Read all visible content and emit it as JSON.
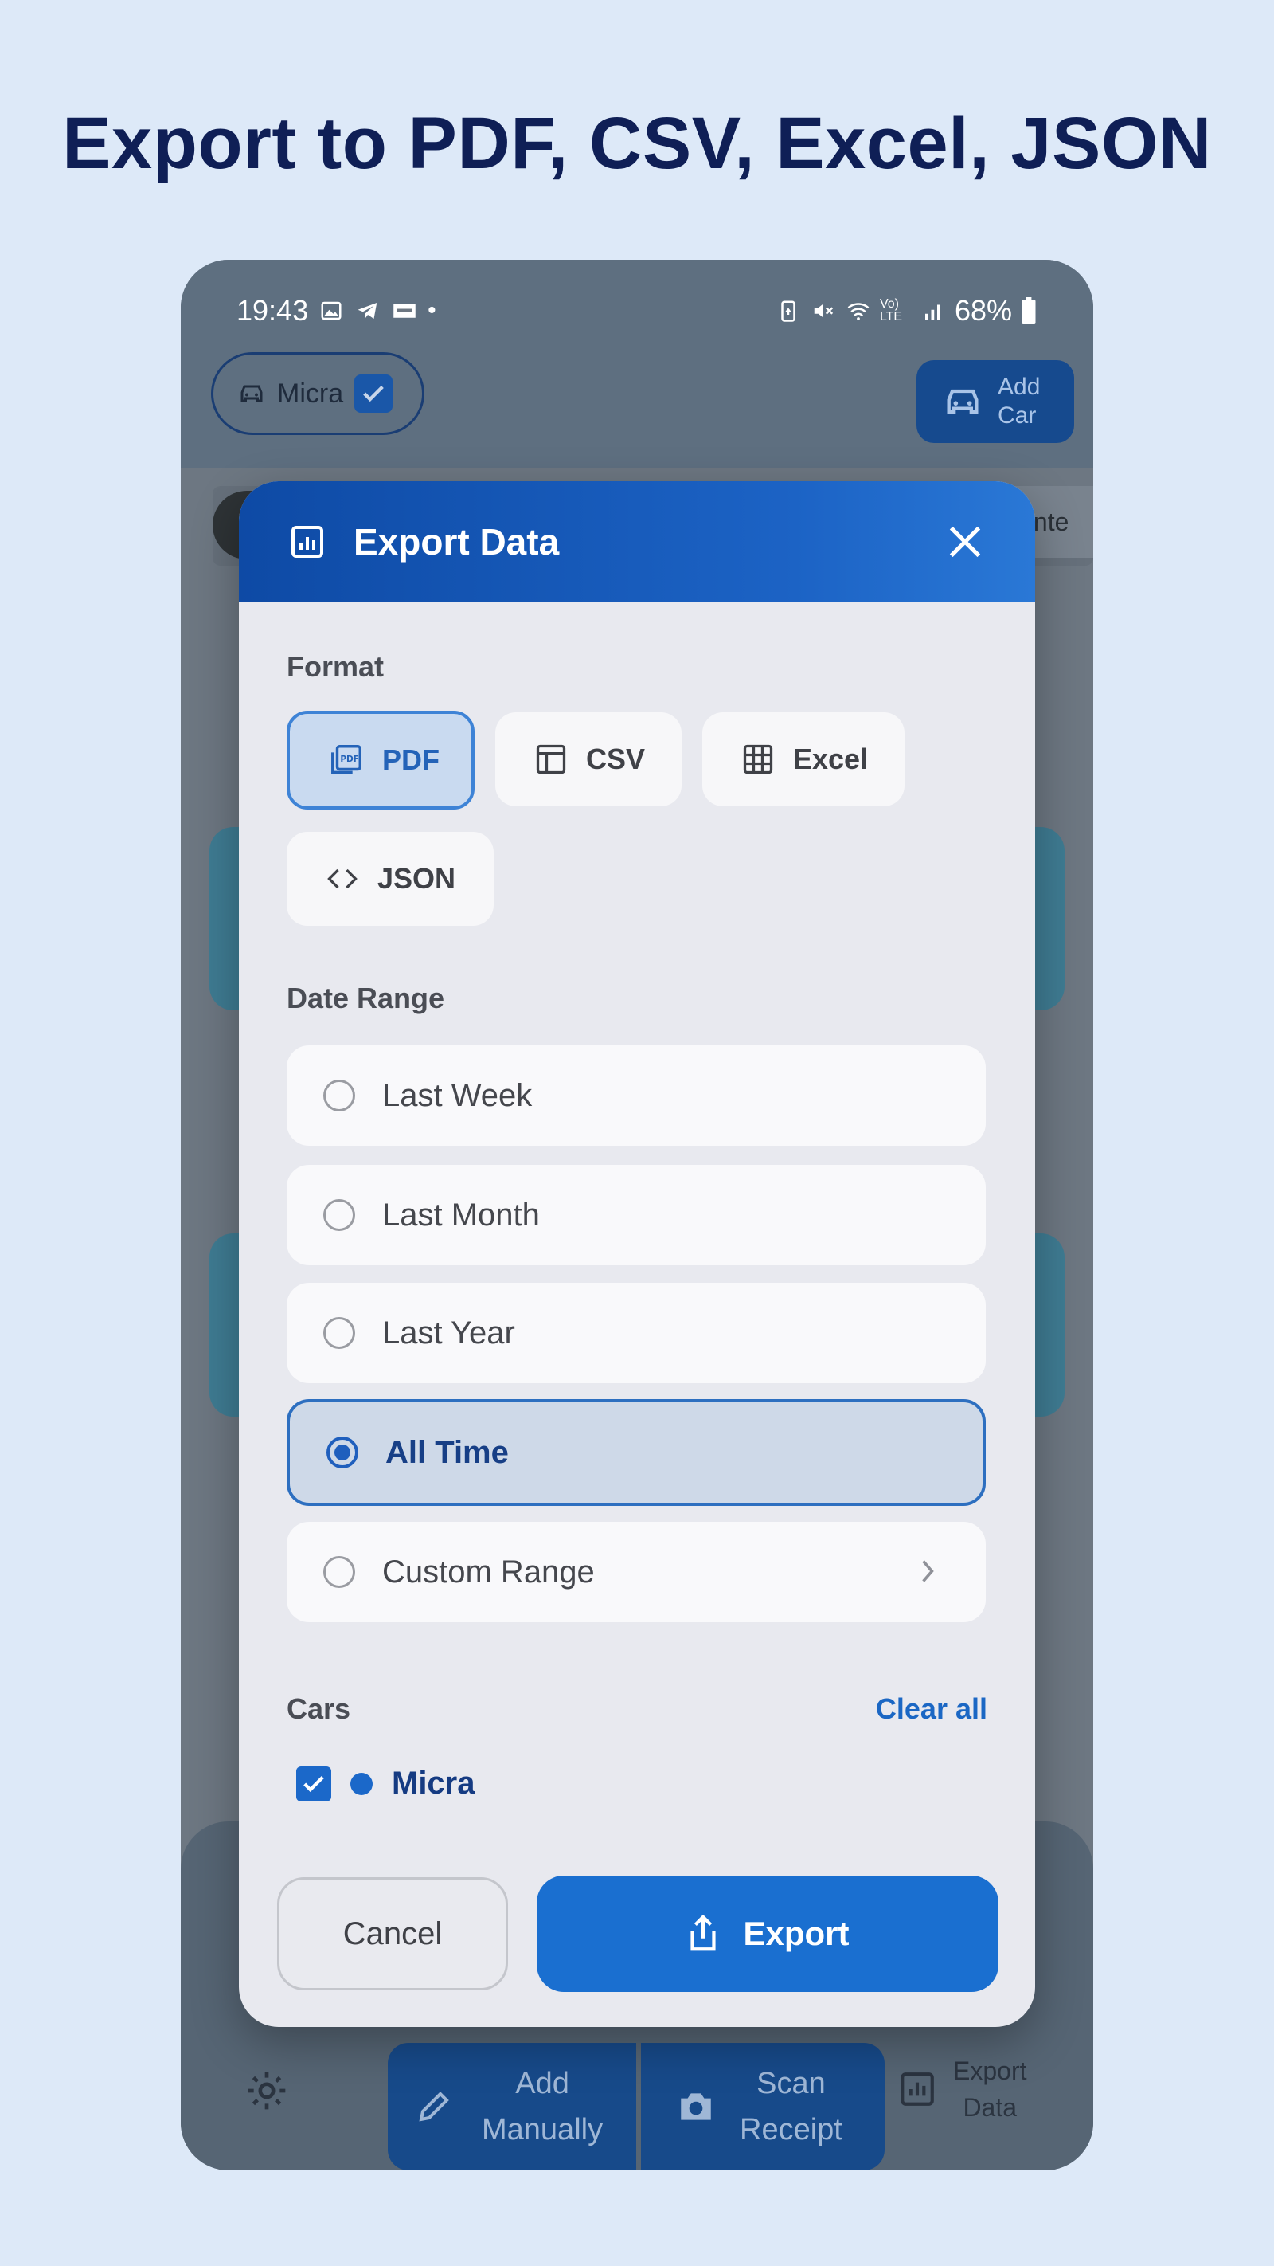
{
  "headline": "Export to PDF, CSV, Excel, JSON",
  "status_bar": {
    "time": "19:43",
    "battery": "68%",
    "network": "Vo) LTE"
  },
  "app": {
    "car_chip_label": "Micra",
    "add_car_line1": "Add",
    "add_car_line2": "Car",
    "bg_tab_text": "ainte"
  },
  "bottom_nav": {
    "add_manually_line1": "Add",
    "add_manually_line2": "Manually",
    "scan_receipt_line1": "Scan",
    "scan_receipt_line2": "Receipt",
    "export_data_line1": "Export",
    "export_data_line2": "Data"
  },
  "modal": {
    "title": "Export Data",
    "format_label": "Format",
    "formats": [
      {
        "label": "PDF",
        "selected": true
      },
      {
        "label": "CSV",
        "selected": false
      },
      {
        "label": "Excel",
        "selected": false
      },
      {
        "label": "JSON",
        "selected": false
      }
    ],
    "date_range_label": "Date Range",
    "date_ranges": [
      {
        "label": "Last Week",
        "selected": false
      },
      {
        "label": "Last Month",
        "selected": false
      },
      {
        "label": "Last Year",
        "selected": false
      },
      {
        "label": "All Time",
        "selected": true
      },
      {
        "label": "Custom Range",
        "selected": false
      }
    ],
    "cars_label": "Cars",
    "clear_all_label": "Clear all",
    "cars": [
      {
        "name": "Micra",
        "checked": true,
        "color": "#1b68c9"
      }
    ],
    "cancel_label": "Cancel",
    "export_label": "Export"
  },
  "colors": {
    "accent": "#1a6fd0",
    "header_start": "#0e4aa5",
    "headline": "#0f1f56"
  }
}
